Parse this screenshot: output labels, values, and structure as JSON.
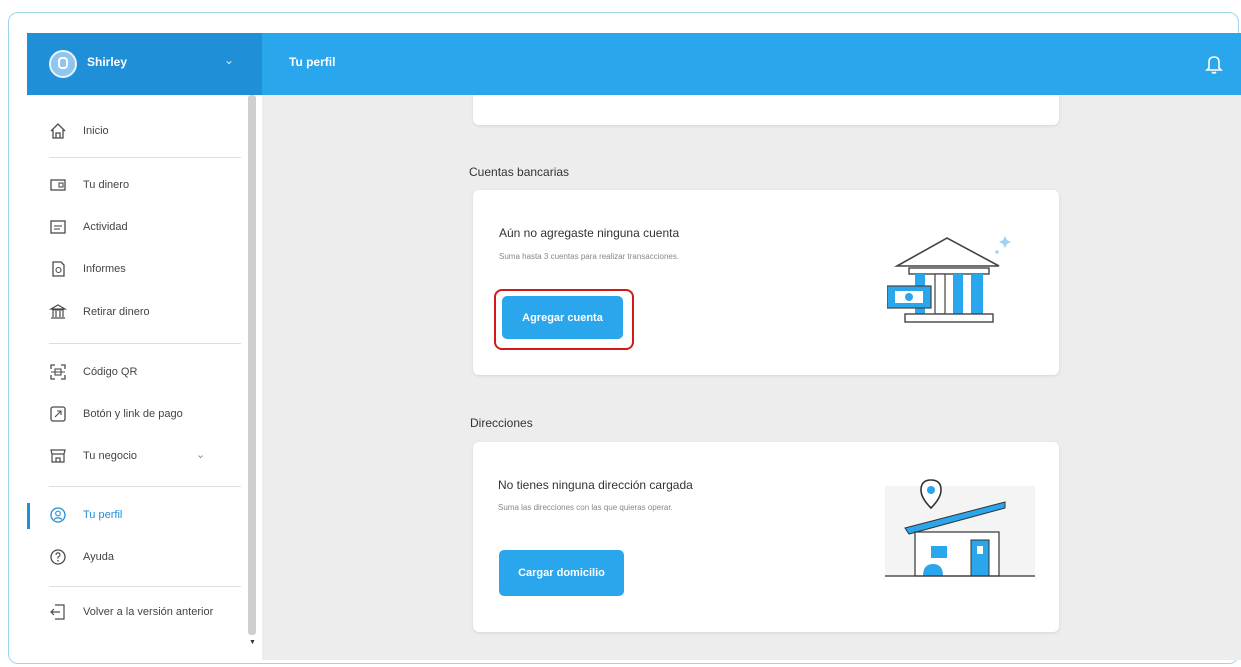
{
  "user": {
    "name": "Shirley"
  },
  "header": {
    "title": "Tu perfil"
  },
  "sidebar": {
    "items": [
      {
        "label": "Inicio",
        "icon": "home-icon"
      },
      {
        "label": "Tu dinero",
        "icon": "wallet-icon"
      },
      {
        "label": "Actividad",
        "icon": "activity-icon"
      },
      {
        "label": "Informes",
        "icon": "report-icon"
      },
      {
        "label": "Retirar dinero",
        "icon": "bank-icon"
      },
      {
        "label": "Código QR",
        "icon": "qr-icon"
      },
      {
        "label": "Botón y link de pago",
        "icon": "payment-link-icon"
      },
      {
        "label": "Tu negocio",
        "icon": "store-icon"
      },
      {
        "label": "Tu perfil",
        "icon": "profile-icon",
        "active": true
      },
      {
        "label": "Ayuda",
        "icon": "help-icon"
      },
      {
        "label": "Volver a la versión anterior",
        "icon": "back-icon"
      }
    ]
  },
  "bank_accounts": {
    "section_title": "Cuentas bancarias",
    "title": "Aún no agregaste ninguna cuenta",
    "subtitle": "Suma hasta 3 cuentas para realizar transacciones.",
    "button": "Agregar cuenta"
  },
  "addresses": {
    "section_title": "Direcciones",
    "title": "No tienes ninguna dirección cargada",
    "subtitle": "Suma las direcciones con las que quieras operar.",
    "button": "Cargar domicilio"
  },
  "colors": {
    "brand": "#2aa6ec",
    "sidebar_header": "#1f8fd8",
    "highlight": "#d21a1a"
  }
}
